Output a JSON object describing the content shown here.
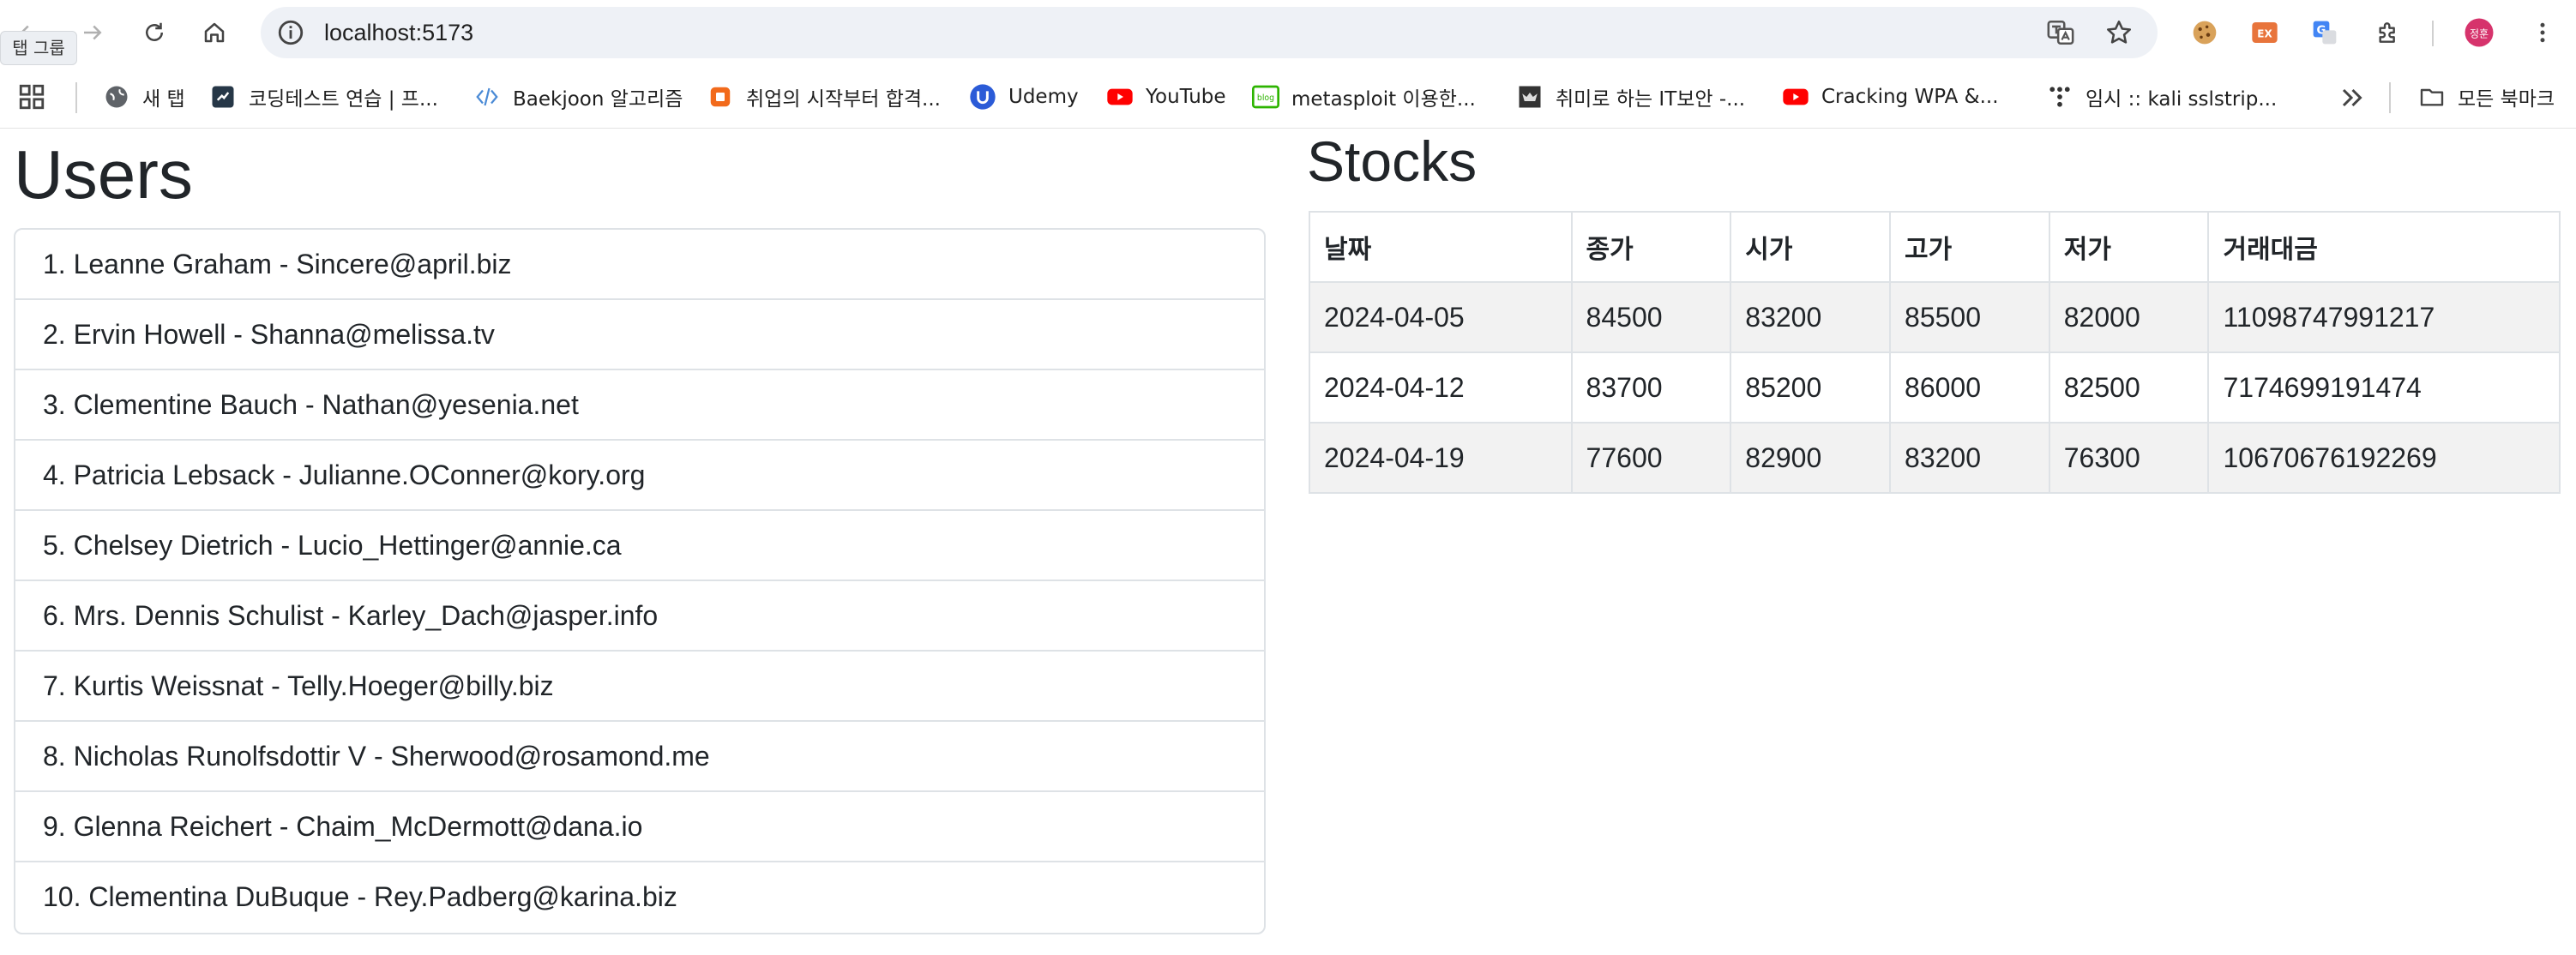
{
  "browser": {
    "url": "localhost:5173",
    "tooltip": "탭 그룹",
    "profile_initials": "정훈",
    "ext_ex_label": "EX",
    "bookmarks": [
      {
        "label": "새 탭",
        "icon": "globe-icon"
      },
      {
        "label": "코딩테스트 연습 | 프...",
        "icon": "programmers-icon"
      },
      {
        "label": "Baekjoon 알고리즘",
        "icon": "code-brackets-icon"
      },
      {
        "label": "취업의 시작부터 합격...",
        "icon": "orange-square-icon"
      },
      {
        "label": "Udemy",
        "icon": "udemy-icon"
      },
      {
        "label": "YouTube",
        "icon": "youtube-icon"
      },
      {
        "label": "metasploit 이용한...",
        "icon": "blog-icon"
      },
      {
        "label": "취미로 하는 IT보안 -...",
        "icon": "dark-site-icon"
      },
      {
        "label": "Cracking WPA &...",
        "icon": "youtube-icon"
      },
      {
        "label": "임시 :: kali sslstrip...",
        "icon": "tistory-icon"
      }
    ],
    "all_bookmarks_label": "모든 북마크"
  },
  "users": {
    "title": "Users",
    "items": [
      "1. Leanne Graham - Sincere@april.biz",
      "2. Ervin Howell - Shanna@melissa.tv",
      "3. Clementine Bauch - Nathan@yesenia.net",
      "4. Patricia Lebsack - Julianne.OConner@kory.org",
      "5. Chelsey Dietrich - Lucio_Hettinger@annie.ca",
      "6. Mrs. Dennis Schulist - Karley_Dach@jasper.info",
      "7. Kurtis Weissnat - Telly.Hoeger@billy.biz",
      "8. Nicholas Runolfsdottir V - Sherwood@rosamond.me",
      "9. Glenna Reichert - Chaim_McDermott@dana.io",
      "10. Clementina DuBuque - Rey.Padberg@karina.biz"
    ]
  },
  "stocks": {
    "title": "Stocks",
    "headers": [
      "날짜",
      "종가",
      "시가",
      "고가",
      "저가",
      "거래대금"
    ],
    "rows": [
      [
        "2024-04-05",
        "84500",
        "83200",
        "85500",
        "82000",
        "11098747991217"
      ],
      [
        "2024-04-12",
        "83700",
        "85200",
        "86000",
        "82500",
        "7174699191474"
      ],
      [
        "2024-04-19",
        "77600",
        "82900",
        "83200",
        "76300",
        "10670676192269"
      ]
    ]
  }
}
